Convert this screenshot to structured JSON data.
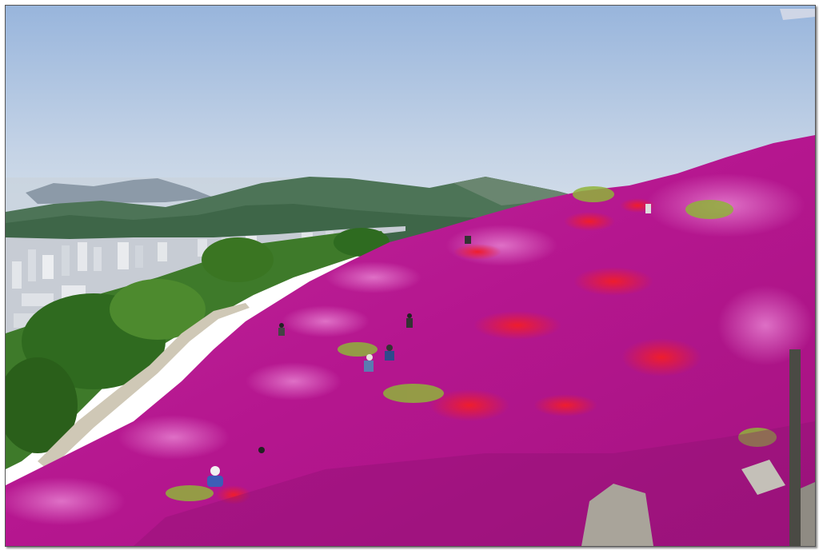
{
  "photo": {
    "subject": "azalea-covered-mountain-slope",
    "colors": {
      "sky_top": "#9bb7dc",
      "sky_bottom": "#d6e1ec",
      "mountain_far": "#6f8494",
      "mountain_near": "#3f6a4a",
      "city": "#c9ced6",
      "trees": "#3b7a2c",
      "azalea_magenta": "#c2249e",
      "azalea_pink": "#e05cc0",
      "azalea_red": "#e8203a",
      "path": "#c8c2b2",
      "rocks": "#a9a59c"
    }
  }
}
